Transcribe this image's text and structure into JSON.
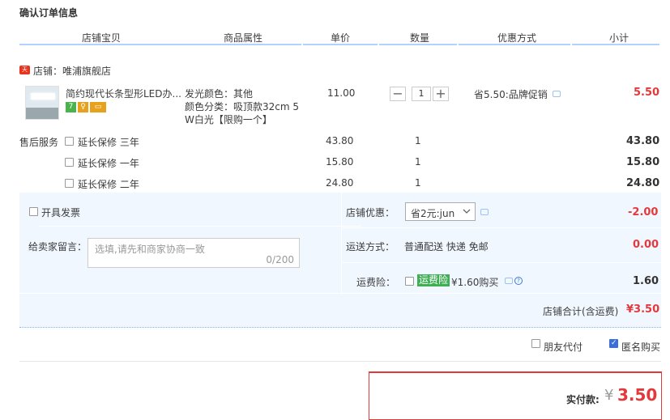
{
  "page_title": "确认订单信息",
  "columns": [
    "店铺宝贝",
    "商品属性",
    "单价",
    "数量",
    "优惠方式",
    "小计"
  ],
  "shop": {
    "icon_text": "天猫",
    "name": "店铺：唯浦旗舰店"
  },
  "item": {
    "title": "简约现代长条型形LED办...",
    "attr1": "发光颜色：其他",
    "attr2": "颜色分类：吸顶款32cm 5",
    "attr3": "W白光【限购一个】",
    "price": "11.00",
    "quantity": "1",
    "minus": "−",
    "plus": "+",
    "promo": "省5.50:品牌促销",
    "subtotal": "5.50",
    "badges": [
      {
        "text": "7",
        "color": "#4bb34b"
      },
      {
        "text": "♀",
        "color": "#e8a11c"
      },
      {
        "text": "▭",
        "color": "#e8a11c"
      }
    ]
  },
  "after_sale": {
    "label": "售后服务",
    "options": [
      {
        "name": "延长保修 三年",
        "price": "43.80",
        "qty": "1",
        "subtotal": "43.80"
      },
      {
        "name": "延长保修 一年",
        "price": "15.80",
        "qty": "1",
        "subtotal": "15.80"
      },
      {
        "name": "延长保修 二年",
        "price": "24.80",
        "qty": "1",
        "subtotal": "24.80"
      }
    ]
  },
  "invoice": {
    "label": "开具发票"
  },
  "message": {
    "label": "给卖家留言：",
    "placeholder": "选填,请先和商家协商一致",
    "counter": "0/200"
  },
  "shop_discount": {
    "label": "店铺优惠：",
    "selected": "省2元:jun",
    "amount": "-2.00"
  },
  "shipping": {
    "label": "运送方式：",
    "value": "普通配送 快递 免邮",
    "amount": "0.00"
  },
  "insurance": {
    "label": "运费险：",
    "tag": "运费险",
    "text": "¥1.60购买",
    "amount": "1.60"
  },
  "shop_total": {
    "label": "店铺合计(含运费)",
    "amount": "¥3.50"
  },
  "options": {
    "friend_pay": "朋友代付",
    "anonymous": "匿名购买"
  },
  "pay": {
    "label": "实付款:",
    "currency": "¥",
    "amount": "3.50"
  },
  "colors": {
    "accent_red": "#e4393c",
    "header_line": "#b2d1ff",
    "panel_bg": "#f1f7ff",
    "tag_green": "#3fae55"
  }
}
